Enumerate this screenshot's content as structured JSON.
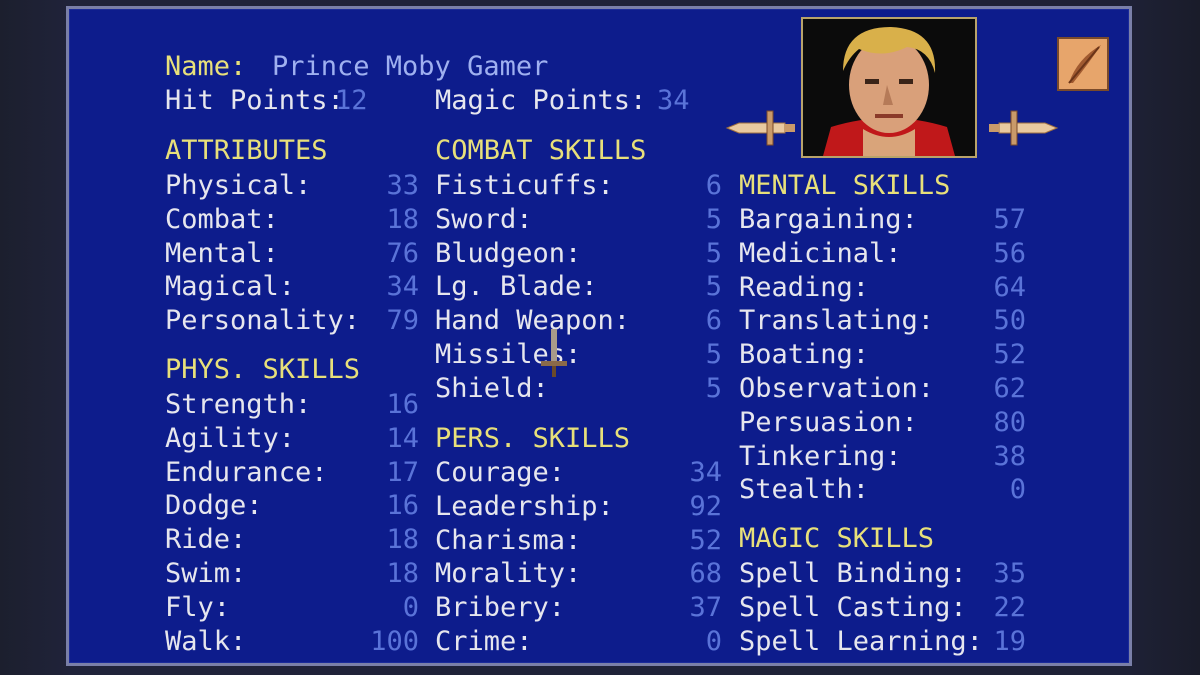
{
  "character": {
    "name_label": "Name:",
    "name": "Prince Moby Gamer",
    "hp_label": "Hit Points:",
    "hp": "12",
    "mp_label": "Magic Points:",
    "mp": "34"
  },
  "attributes": {
    "header": "ATTRIBUTES",
    "items": [
      {
        "label": "Physical:",
        "value": "33"
      },
      {
        "label": "Combat:",
        "value": "18"
      },
      {
        "label": "Mental:",
        "value": "76"
      },
      {
        "label": "Magical:",
        "value": "34"
      },
      {
        "label": "Personality:",
        "value": "79"
      }
    ]
  },
  "phys_skills": {
    "header": "PHYS. SKILLS",
    "items": [
      {
        "label": "Strength:",
        "value": "16"
      },
      {
        "label": "Agility:",
        "value": "14"
      },
      {
        "label": "Endurance:",
        "value": "17"
      },
      {
        "label": "Dodge:",
        "value": "16"
      },
      {
        "label": "Ride:",
        "value": "18"
      },
      {
        "label": "Swim:",
        "value": "18"
      },
      {
        "label": "Fly:",
        "value": "0"
      },
      {
        "label": "Walk:",
        "value": "100"
      }
    ]
  },
  "combat_skills": {
    "header": "COMBAT SKILLS",
    "items": [
      {
        "label": "Fisticuffs:",
        "value": "6"
      },
      {
        "label": "Sword:",
        "value": "5"
      },
      {
        "label": "Bludgeon:",
        "value": "5"
      },
      {
        "label": "Lg. Blade:",
        "value": "5"
      },
      {
        "label": "Hand Weapon:",
        "value": "6"
      },
      {
        "label": "Missiles:",
        "value": "5"
      },
      {
        "label": "Shield:",
        "value": "5"
      }
    ]
  },
  "pers_skills": {
    "header": "PERS. SKILLS",
    "items": [
      {
        "label": "Courage:",
        "value": "34"
      },
      {
        "label": "Leadership:",
        "value": "92"
      },
      {
        "label": "Charisma:",
        "value": "52"
      },
      {
        "label": "Morality:",
        "value": "68"
      },
      {
        "label": "Bribery:",
        "value": "37"
      },
      {
        "label": "Crime:",
        "value": "0"
      }
    ]
  },
  "mental_skills": {
    "header": "MENTAL SKILLS",
    "items": [
      {
        "label": "Bargaining:",
        "value": "57"
      },
      {
        "label": "Medicinal:",
        "value": "56"
      },
      {
        "label": "Reading:",
        "value": "64"
      },
      {
        "label": "Translating:",
        "value": "50"
      },
      {
        "label": "Boating:",
        "value": "52"
      },
      {
        "label": "Observation:",
        "value": "62"
      },
      {
        "label": "Persuasion:",
        "value": "80"
      },
      {
        "label": "Tinkering:",
        "value": "38"
      },
      {
        "label": "Stealth:",
        "value": "0"
      }
    ]
  },
  "magic_skills": {
    "header": "MAGIC SKILLS",
    "items": [
      {
        "label": "Spell Binding:",
        "value": "35"
      },
      {
        "label": "Spell Casting:",
        "value": "22"
      },
      {
        "label": "Spell Learning:",
        "value": "19"
      }
    ]
  },
  "icons": {
    "portrait": "character-portrait",
    "prev": "sword-left-arrow-icon",
    "next": "sword-right-arrow-icon",
    "journal": "quill-book-icon"
  },
  "colors": {
    "panel": "#0d1c8c",
    "header": "#e8e07a",
    "label": "#e6e6ee",
    "value": "#5a73d8",
    "name": "#9fb0f0"
  }
}
